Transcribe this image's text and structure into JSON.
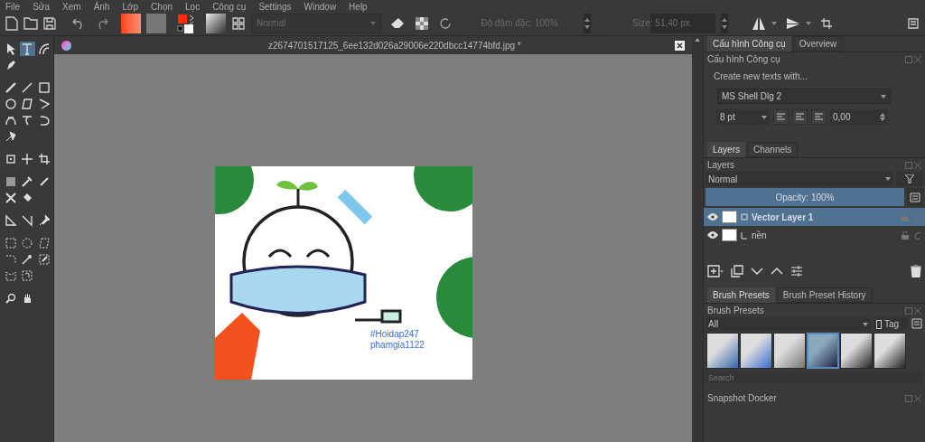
{
  "menu_bar": [
    "File",
    "Sửa",
    "Xem",
    "Ảnh",
    "Lớp",
    "Chọn",
    "Lọc",
    "Công cụ",
    "Settings",
    "Window",
    "Help"
  ],
  "toolbar": {
    "blend_mode": "Normal",
    "opacity": {
      "reading": "Độ đậm đặc: 100%",
      "level": 1
    },
    "size": {
      "reading": "Size: 51,40 px",
      "level": 0.4
    }
  },
  "toolbox": {
    "groups": [
      [
        {
          "selected": false
        },
        {
          "selected": true
        },
        {
          "selected": false
        },
        {
          "selected": false
        }
      ],
      [
        {
          "selected": false
        },
        {
          "selected": false
        },
        {
          "selected": false
        },
        {
          "selected": false
        },
        {
          "selected": false
        },
        {
          "selected": false
        },
        {
          "selected": false
        },
        {
          "selected": false
        },
        {
          "selected": false
        },
        {
          "selected": false
        }
      ],
      [
        {
          "selected": false
        },
        {
          "selected": false
        },
        {
          "selected": false
        }
      ],
      [
        {
          "selected": false
        },
        {
          "selected": false
        },
        {
          "selected": false
        },
        {
          "selected": false
        },
        {
          "selected": false
        }
      ],
      [
        {
          "selected": false
        },
        {
          "selected": false
        },
        {
          "selected": false
        }
      ],
      [
        {
          "selected": false
        },
        {
          "selected": false
        },
        {
          "selected": false
        },
        {
          "selected": false
        },
        {
          "selected": false
        },
        {
          "selected": false
        },
        {
          "selected": false
        },
        {
          "selected": false
        }
      ],
      [
        {
          "selected": false
        },
        {
          "selected": false
        }
      ]
    ]
  },
  "document": {
    "tab_title": "z2674701517125_6ee132d026a29006e220dbcc14774bfd.jpg *",
    "canvas_texts": [
      "#Hoidap247",
      "phamgia1122"
    ]
  },
  "tool_options": {
    "tabs": [
      {
        "label": "Cấu hình Công cụ",
        "selected": true
      },
      {
        "label": "Overview",
        "selected": false
      }
    ],
    "title": "Cấu hình Công cụ",
    "heading": "Create new texts with...",
    "font": "MS Shell Dlg 2",
    "font_size": "8 pt",
    "spacing": "0,00"
  },
  "layers_docker": {
    "tabs": [
      {
        "label": "Layers",
        "selected": true
      },
      {
        "label": "Channels",
        "selected": false
      }
    ],
    "title": "Layers",
    "blend_mode": "Normal",
    "opacity": {
      "reading": "Opacity:  100%",
      "level": 1
    },
    "layers": [
      {
        "name": "Vector Layer 1",
        "kind": "vector",
        "selected": true
      },
      {
        "name": "nền",
        "kind": "paint",
        "selected": false
      }
    ]
  },
  "brush_docker": {
    "tabs": [
      {
        "label": "Brush Presets",
        "selected": true
      },
      {
        "label": "Brush Preset History",
        "selected": false
      }
    ],
    "title": "Brush Presets",
    "filter": "All",
    "tag": "Tag",
    "search_placeholder": "Search",
    "presets": [
      {
        "selected": false
      },
      {
        "selected": false
      },
      {
        "selected": false
      },
      {
        "selected": true
      },
      {
        "selected": false
      },
      {
        "selected": false
      }
    ]
  },
  "snapshot_docker": {
    "title": "Snapshot Docker"
  }
}
